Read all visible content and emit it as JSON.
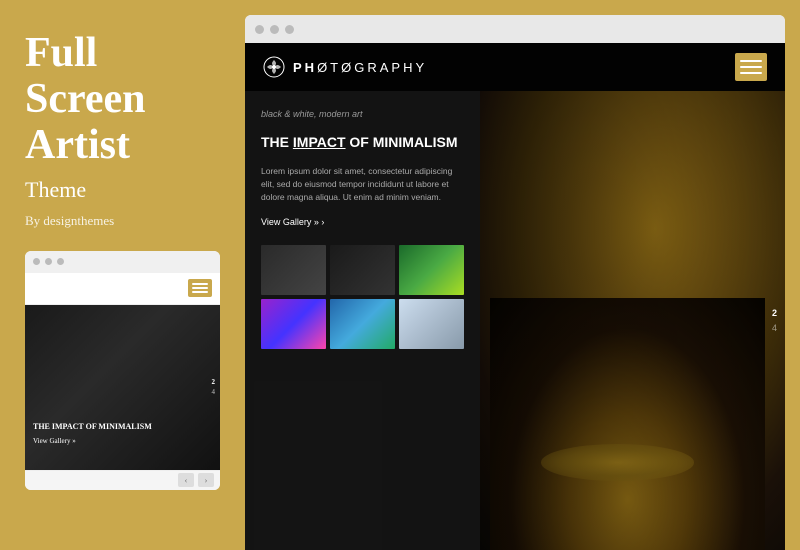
{
  "left": {
    "title": "Full Screen Artist",
    "subtitle": "Theme",
    "by": "By designthemes",
    "mini_titlebar_dots": [
      "dot1",
      "dot2",
      "dot3"
    ],
    "mini_page_numbers": [
      "2",
      "4"
    ],
    "mini_text": "THE IMPACT OF MINIMALISM",
    "mini_view_gallery": "View Gallery »"
  },
  "browser": {
    "titlebar_dots": [
      "dot1",
      "dot2",
      "dot3"
    ],
    "logo": {
      "text_ph": "Ph",
      "text_rest": "ØTØGrАPhY"
    },
    "article": {
      "meta": "black & white, modern art",
      "title_part1": "THE ",
      "title_underline": "IMPACT",
      "title_part2": " OF MINIMALISM",
      "body": "Lorem ipsum dolor sit amet, consectetur adipiscing elit, sed do eiusmod tempor incididunt ut labore et dolore magna aliqua. Ut enim ad minim veniam.",
      "view_gallery": "View Gallery »"
    },
    "page_numbers": [
      "2",
      "4"
    ],
    "gallery_thumbs": [
      {
        "id": 1,
        "class": "thumb-1"
      },
      {
        "id": 2,
        "class": "thumb-2"
      },
      {
        "id": 3,
        "class": "thumb-3"
      },
      {
        "id": 4,
        "class": "thumb-4"
      },
      {
        "id": 5,
        "class": "thumb-5"
      },
      {
        "id": 6,
        "class": "thumb-6"
      }
    ]
  }
}
